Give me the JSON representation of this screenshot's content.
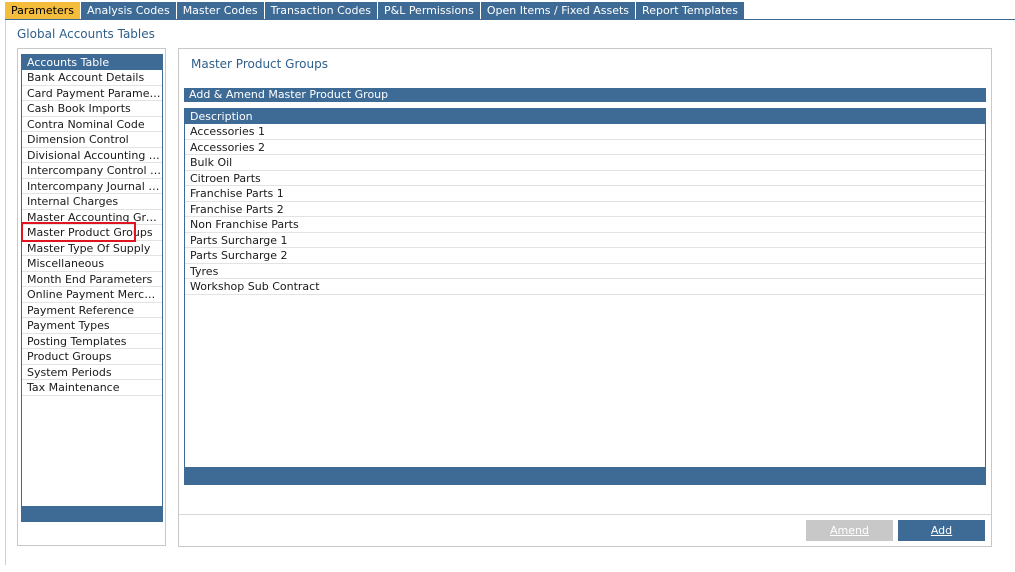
{
  "tabs": [
    {
      "label": "Parameters",
      "active": true
    },
    {
      "label": "Analysis Codes",
      "active": false
    },
    {
      "label": "Master Codes",
      "active": false
    },
    {
      "label": "Transaction Codes",
      "active": false
    },
    {
      "label": "P&L Permissions",
      "active": false
    },
    {
      "label": "Open Items / Fixed Assets",
      "active": false
    },
    {
      "label": "Report Templates",
      "active": false
    }
  ],
  "section_title": "Global Accounts Tables",
  "sidebar": {
    "header": "Accounts Table",
    "selected": "Master Product Groups",
    "items": [
      "Bank Account Details",
      "Card Payment Parameters",
      "Cash Book Imports",
      "Contra Nominal Code",
      "Dimension Control",
      "Divisional Accounting Gro...",
      "Intercompany Control Co...",
      "Intercompany Journal Co...",
      "Internal Charges",
      "Master Accounting Groups",
      "Master Product Groups",
      "Master Type Of Supply",
      "Miscellaneous",
      "Month End Parameters",
      "Online Payment Merchants",
      "Payment Reference",
      "Payment Types",
      "Posting Templates",
      "Product Groups",
      "System Periods",
      "Tax Maintenance"
    ]
  },
  "main": {
    "title": "Master Product Groups",
    "amend_header": "Add & Amend Master Product Group",
    "grid": {
      "column": "Description",
      "rows": [
        "Accessories 1",
        "Accessories 2",
        "Bulk Oil",
        "Citroen Parts",
        "Franchise Parts 1",
        "Franchise Parts 2",
        "Non Franchise Parts",
        "Parts Surcharge 1",
        "Parts Surcharge 2",
        "Tyres",
        "Workshop Sub Contract"
      ]
    },
    "buttons": {
      "amend": "Amend",
      "add": "Add"
    }
  },
  "colors": {
    "accent": "#3d6b96",
    "active_tab": "#f5bd3c",
    "highlight": "#e0141e",
    "disabled_button": "#c8c8c8"
  }
}
